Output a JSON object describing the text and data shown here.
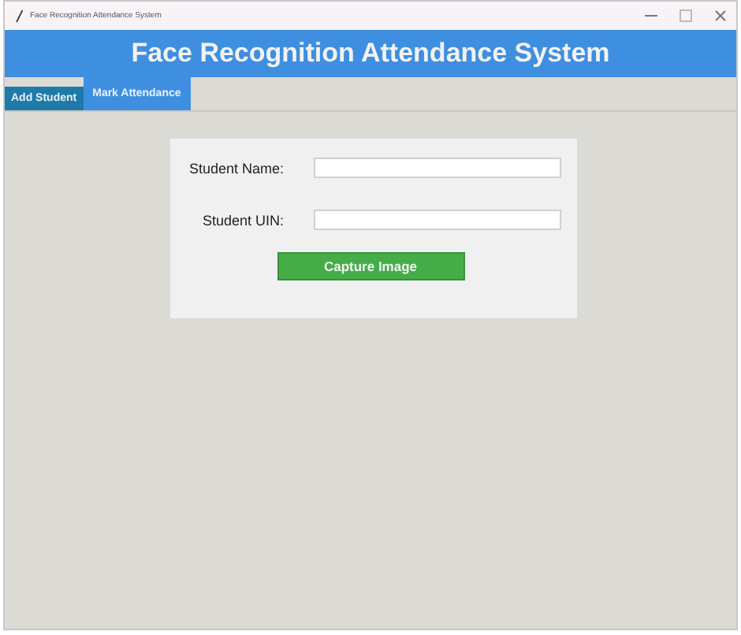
{
  "window": {
    "title": "Face Recognition Attendance System"
  },
  "header": {
    "title": "Face Recognition Attendance System"
  },
  "tabs": [
    {
      "label": "Add Student",
      "selected": false
    },
    {
      "label": "Mark Attendance",
      "selected": true
    }
  ],
  "form": {
    "fields": [
      {
        "label": "Student Name:"
      },
      {
        "label": "Student UIN:"
      }
    ],
    "button": "Capture Image"
  }
}
